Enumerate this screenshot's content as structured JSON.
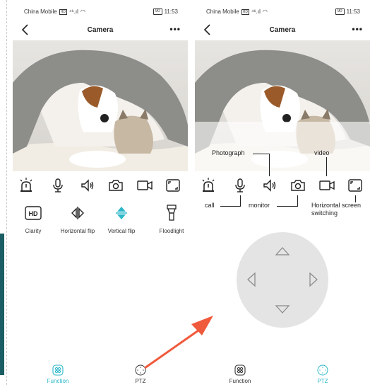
{
  "status_bar": {
    "carrier": "China Mobile",
    "sim": "HD",
    "signal": "⁴⁶.ıl",
    "wifi": "◠",
    "battery": "90",
    "time": "11:53"
  },
  "nav": {
    "title": "Camera",
    "more": "•••"
  },
  "tabs": [
    {
      "label": "Function"
    },
    {
      "label": "PTZ"
    }
  ],
  "functions": {
    "clarity": "Clarity",
    "clarity_badge": "HD",
    "hflip": "Horizontal flip",
    "vflip": "Vertical flip",
    "floodlight": "Floodlight"
  },
  "annotations": {
    "photograph": "Photograph",
    "video": "video",
    "call": "call",
    "monitor": "monitor",
    "horizontal_1": "Horizontal screen",
    "horizontal_2": "switching"
  },
  "colors": {
    "accent": "#2bb7c8",
    "arrow": "#f05a3c",
    "pad": "#e4e4e4"
  },
  "icons": [
    "back-icon",
    "more-icon",
    "alarm-icon",
    "microphone-icon",
    "speaker-icon",
    "camera-icon",
    "video-icon",
    "fullscreen-icon",
    "hd-icon",
    "horizontal-flip-icon",
    "vertical-flip-icon",
    "floodlight-icon",
    "function-grid-icon",
    "ptz-icon"
  ]
}
